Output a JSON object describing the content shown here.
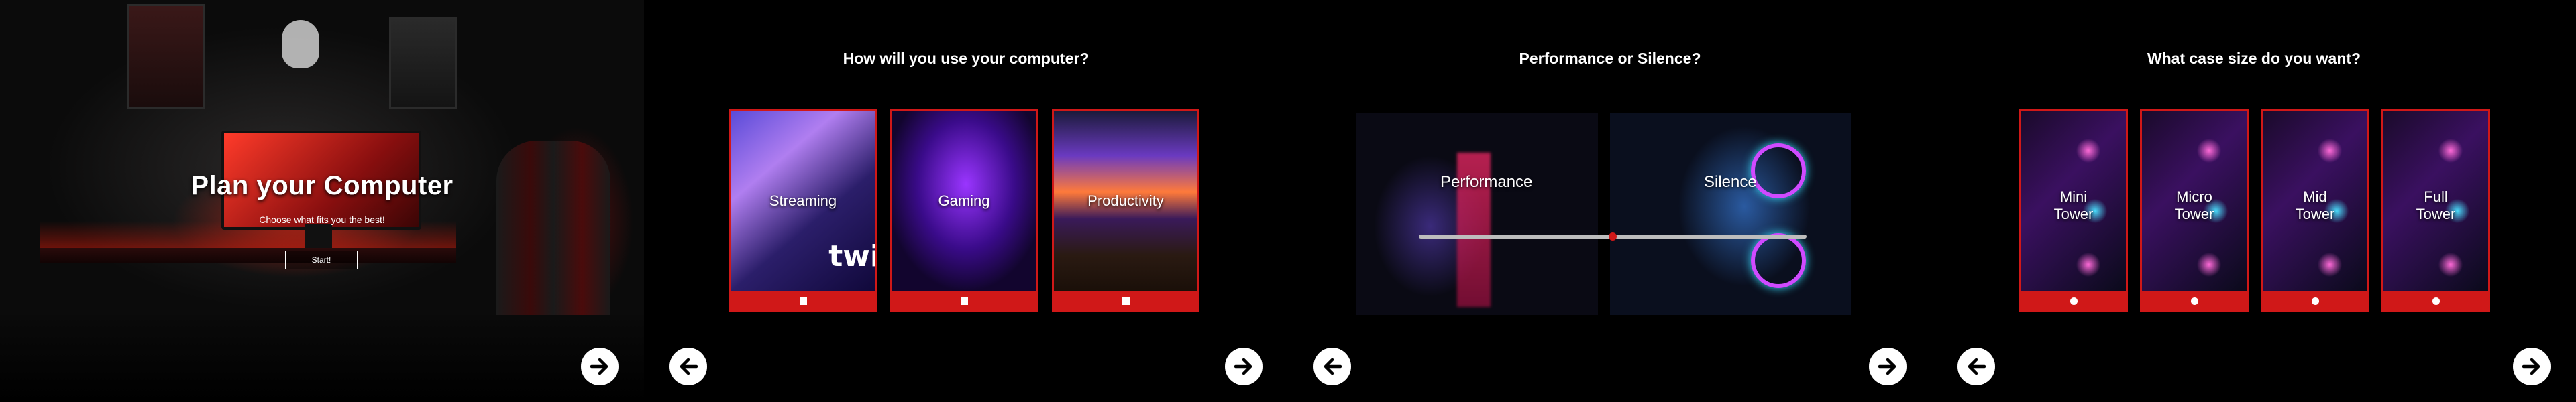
{
  "intro": {
    "title": "Plan your Computer",
    "subtitle": "Choose what fits you the best!",
    "start_label": "Start!"
  },
  "usage": {
    "title": "How will you use your computer?",
    "options": [
      {
        "label": "Streaming",
        "selector": "checkbox",
        "checked": false
      },
      {
        "label": "Gaming",
        "selector": "checkbox",
        "checked": false
      },
      {
        "label": "Productivity",
        "selector": "checkbox",
        "checked": false
      }
    ]
  },
  "performance": {
    "title": "Performance or Silence?",
    "left_label": "Performance",
    "right_label": "Silence",
    "slider_value": 0.5
  },
  "case_size": {
    "title": "What case size do you want?",
    "options": [
      {
        "label": "Mini\nTower",
        "selector": "radio",
        "selected": false
      },
      {
        "label": "Micro\nTower",
        "selector": "radio",
        "selected": false
      },
      {
        "label": "Mid\nTower",
        "selector": "radio",
        "selected": false
      },
      {
        "label": "Full\nTower",
        "selector": "radio",
        "selected": false
      }
    ]
  },
  "navigation": {
    "prev_icon": "arrow-left-icon",
    "next_icon": "arrow-right-icon"
  },
  "colors": {
    "accent": "#d01818",
    "background": "#000000",
    "text": "#ffffff"
  }
}
